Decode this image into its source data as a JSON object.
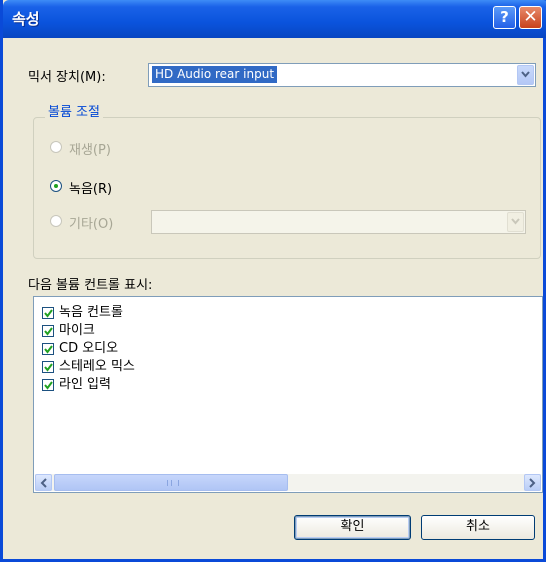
{
  "window": {
    "title": "속성",
    "help_glyph": "?",
    "close_glyph": "✕"
  },
  "mixer": {
    "label": "믹서 장치(M):",
    "selected": "HD Audio rear input"
  },
  "volume_group": {
    "title": "볼륨 조절",
    "options": [
      {
        "label": "재생(P)",
        "selected": false,
        "enabled": false
      },
      {
        "label": "녹음(R)",
        "selected": true,
        "enabled": true
      },
      {
        "label": "기타(O)",
        "selected": false,
        "enabled": false
      }
    ]
  },
  "show_controls": {
    "label": "다음 볼륨 컨트롤 표시:",
    "items": [
      {
        "label": "녹음 컨트롤",
        "checked": true
      },
      {
        "label": "마이크",
        "checked": true
      },
      {
        "label": "CD 오디오",
        "checked": true
      },
      {
        "label": "스테레오 믹스",
        "checked": true
      },
      {
        "label": "라인 입력",
        "checked": true
      }
    ]
  },
  "buttons": {
    "ok": "확인",
    "cancel": "취소"
  },
  "colors": {
    "title_bar": "#0a53dc",
    "selection": "#316ac5",
    "group_title": "#0046d5",
    "dialog_bg": "#ece9d8"
  }
}
